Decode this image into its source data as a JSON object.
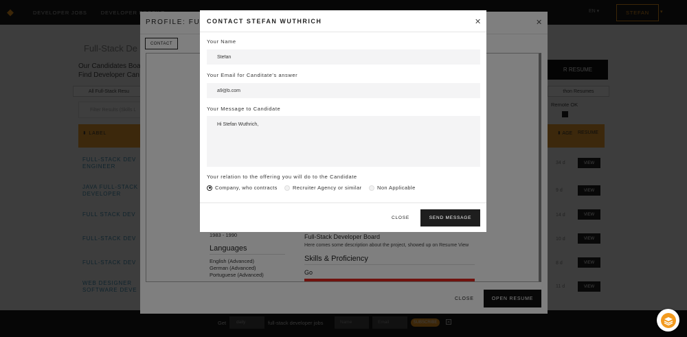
{
  "topnav": {
    "items": [
      "DEVELOPER JOBS",
      "DEVELOPER PROFILE"
    ],
    "lang": "EN",
    "user": "STEFAN"
  },
  "background": {
    "title": "Full-Stack De",
    "subtitle_line1": "Our Candidates Boa",
    "subtitle_line2": "Find Developer Can",
    "tab_all": "All Full-Stack Resu",
    "filter_placeholder": "Filter Results (Skills L",
    "submit_resume": "R RESUME",
    "category_tab": "thon Resumes",
    "remote_label": "Remote OK",
    "header": {
      "label": "⬍ LABEL",
      "age": "⬍ AGE",
      "resume": "RESUME"
    },
    "rows": [
      {
        "title": "FULL-STACK DEV\nENGINEER",
        "age": "34 d",
        "view": "VIEW"
      },
      {
        "title": "JAVA FULL-STACK\nDEVELOPER",
        "age": "9 d",
        "view": "VIEW"
      },
      {
        "title": "FULL STACK DEV",
        "age": "14 d",
        "view": "VIEW"
      },
      {
        "title": "FULL-STACK DEV",
        "age": "10 d",
        "view": "VIEW"
      },
      {
        "title": "FULL-STACK DEV",
        "age": "8 d",
        "view": "VIEW"
      },
      {
        "title": "WEB DESIGNER\nSOFTWARE DEVE",
        "age": "11 d",
        "view": "VIEW"
      }
    ]
  },
  "profile_modal": {
    "title": "PROFILE: FULL",
    "contact_tab": "CONTACT",
    "years": "1983 - 1990",
    "languages_heading": "Languages",
    "languages": [
      "English (Advanced)",
      "German (Advanced)",
      "Portuguese (Advanced)"
    ],
    "project_title": "Full-Stack Developer Board",
    "project_desc": "Here comes some description about the project, showed up on Resume View",
    "skills_heading": "Skills & Proficiency",
    "skill_name": "Go",
    "close_label": "CLOSE",
    "open_label": "OPEN RESUME"
  },
  "contact_modal": {
    "title": "CONTACT STEFAN WUTHRICH",
    "name_label": "Your Name",
    "name_value": "Stefan",
    "email_label": "Your Email for Canditate's answer",
    "email_value": "a9@b.com",
    "message_label": "Your Message to Candidate",
    "message_value": "Hi Stefan Wuthrich,",
    "relation_label": "Your relation to the offering you will do to the Candidate",
    "relations": [
      "Company, who contracts",
      "Recruiter Agency or similar",
      "Non Applicable"
    ],
    "selected_relation": 0,
    "close_label": "CLOSE",
    "send_label": "SEND MESSAGE"
  },
  "bottombar": {
    "get_text": "Get",
    "frequency": "daily",
    "jobs_text": "full-stack developer jobs",
    "name_placeholder": "Name",
    "email_placeholder": "Email",
    "subscribe_label": "SUBSCRIBE"
  },
  "colors": {
    "accent": "#f29a1f",
    "danger": "#e0241d",
    "dark": "#1e1e1e"
  },
  "icons": [
    "logo-icon",
    "close-icon",
    "chevron-down-icon",
    "chat-stack-icon"
  ]
}
